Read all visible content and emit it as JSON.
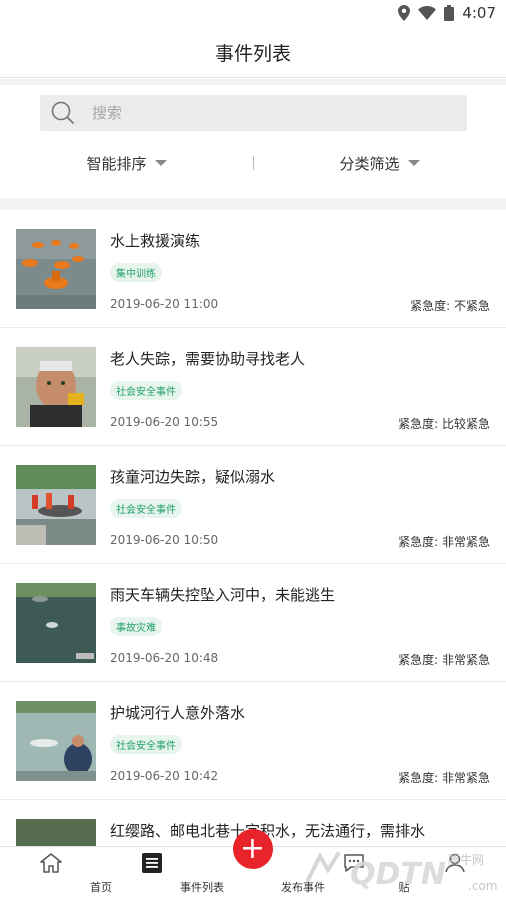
{
  "status_bar": {
    "time": "4:07",
    "icons": [
      "location-icon",
      "wifi-icon",
      "battery-icon"
    ]
  },
  "header": {
    "title": "事件列表"
  },
  "search": {
    "placeholder": "搜索"
  },
  "filters": {
    "sort_label": "智能排序",
    "category_label": "分类筛选"
  },
  "events": [
    {
      "title": "水上救援演练",
      "tag": "集中训练",
      "date": "2019-06-20 11:00",
      "urgency": "紧急度: 不紧急"
    },
    {
      "title": "老人失踪，需要协助寻找老人",
      "tag": "社会安全事件",
      "date": "2019-06-20 10:55",
      "urgency": "紧急度: 比较紧急"
    },
    {
      "title": "孩童河边失踪，疑似溺水",
      "tag": "社会安全事件",
      "date": "2019-06-20 10:50",
      "urgency": "紧急度: 非常紧急"
    },
    {
      "title": "雨天车辆失控坠入河中，未能逃生",
      "tag": "事故灾难",
      "date": "2019-06-20 10:48",
      "urgency": "紧急度: 非常紧急"
    },
    {
      "title": "护城河行人意外落水",
      "tag": "社会安全事件",
      "date": "2019-06-20 10:42",
      "urgency": "紧急度: 非常紧急"
    },
    {
      "title": "红缨路、邮电北巷十字积水，无法通行，需排水",
      "tag": "",
      "date": "",
      "urgency": ""
    }
  ],
  "nav": {
    "home": "首页",
    "events": "事件列表",
    "publish": "发布事件",
    "posts": "贴",
    "mine": ""
  },
  "colors": {
    "accent": "#e8232a",
    "tag_text": "#22a06b",
    "tag_bg": "#e8f5ee"
  }
}
